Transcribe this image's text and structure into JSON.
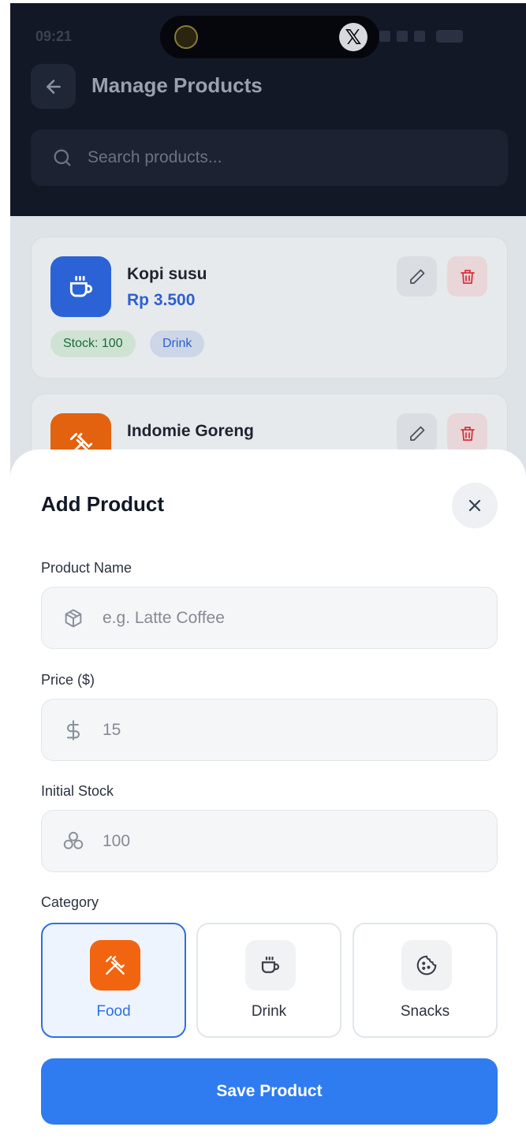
{
  "status": {
    "time": "09:21"
  },
  "header": {
    "title": "Manage Products"
  },
  "search": {
    "placeholder": "Search products..."
  },
  "products": [
    {
      "name": "Kopi susu",
      "price": "Rp 3.500",
      "stock_tag": "Stock: 100",
      "category_tag": "Drink",
      "icon": "cup-icon",
      "color": "#2b63d6"
    },
    {
      "name": "Indomie Goreng",
      "icon": "utensils-icon",
      "color": "#e2620f"
    }
  ],
  "modal": {
    "title": "Add Product",
    "fields": {
      "name": {
        "label": "Product Name",
        "placeholder": "e.g. Latte Coffee"
      },
      "price": {
        "label": "Price ($)",
        "value": "15"
      },
      "stock": {
        "label": "Initial Stock",
        "value": "100"
      }
    },
    "category": {
      "label": "Category",
      "selected": "Food",
      "options": [
        {
          "label": "Food",
          "icon": "utensils-icon"
        },
        {
          "label": "Drink",
          "icon": "cup-icon"
        },
        {
          "label": "Snacks",
          "icon": "cookie-icon"
        }
      ]
    },
    "save_label": "Save Product"
  },
  "colors": {
    "accent": "#2f7bf0",
    "food": "#f26510",
    "dark": "#121826"
  }
}
